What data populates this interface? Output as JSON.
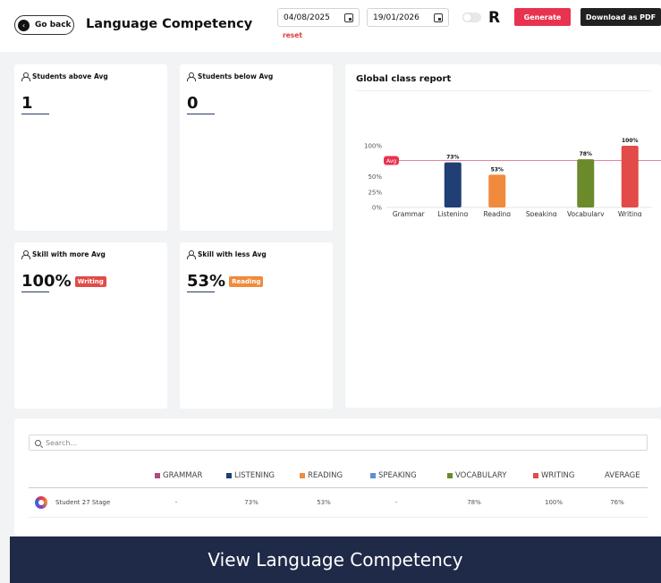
{
  "header": {
    "back_label": "Go back",
    "title": "Language Competency",
    "start_date": "04/08/2025",
    "end_date": "19/01/2026",
    "reset_label": "reset",
    "logo_text": "R",
    "generate_label": "Generate",
    "pdf_label": "Download as PDF"
  },
  "stats": {
    "above_avg_label": "Students above Avg",
    "above_avg_value": "1",
    "below_avg_label": "Students below Avg",
    "below_avg_value": "0",
    "more_avg_label": "Skill with more Avg",
    "more_avg_value": "100%",
    "more_avg_skill": "Writing",
    "less_avg_label": "Skill with less Avg",
    "less_avg_value": "53%",
    "less_avg_skill": "Reading"
  },
  "chart_data": {
    "type": "bar",
    "title": "Global class report",
    "categories": [
      "Grammar",
      "Listening",
      "Reading",
      "Speaking",
      "Vocabulary",
      "Writing"
    ],
    "values": [
      null,
      73,
      53,
      null,
      78,
      100
    ],
    "value_labels": [
      "",
      "73%",
      "53%",
      "",
      "78%",
      "100%"
    ],
    "colors": [
      "#b04a7a",
      "#1f3f75",
      "#f08a3c",
      "#5b8ed6",
      "#6b8a2c",
      "#e24b47"
    ],
    "yticks": [
      "0%",
      "25%",
      "50%",
      "100%"
    ],
    "ylim": [
      0,
      100
    ],
    "avg_label": "Avg",
    "avg_value": 76,
    "grid": false
  },
  "table": {
    "search_placeholder": "Search...",
    "headers": [
      "GRAMMAR",
      "LISTENING",
      "READING",
      "SPEAKING",
      "VOCABULARY",
      "WRITING",
      "AVERAGE"
    ],
    "header_colors": [
      "#b04a7a",
      "#1f3f75",
      "#f08a3c",
      "#5b8ed6",
      "#6b8a2c",
      "#e24b47",
      ""
    ],
    "rows": [
      {
        "name": "Student 27 Stage",
        "cells": [
          "-",
          "73%",
          "53%",
          "-",
          "78%",
          "100%",
          "76%"
        ]
      }
    ]
  },
  "footer": {
    "text": "View Language Competency"
  }
}
